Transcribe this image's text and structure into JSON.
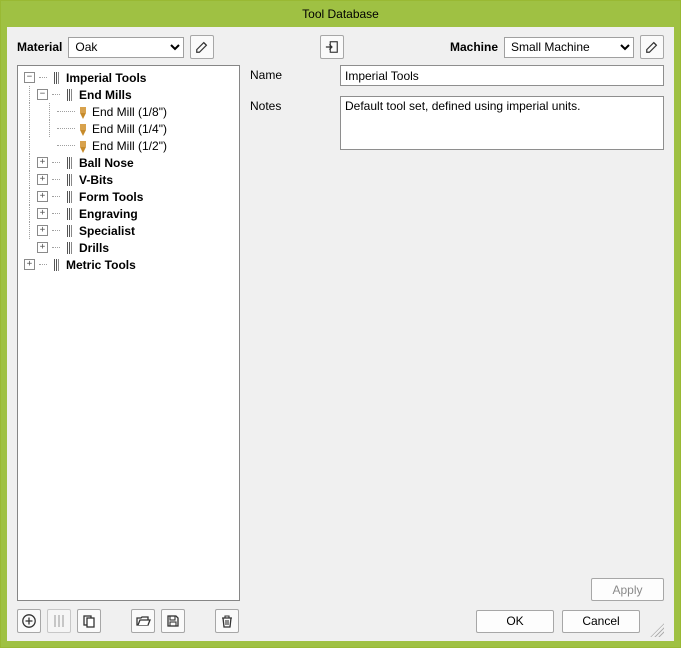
{
  "window": {
    "title": "Tool Database"
  },
  "toolbar": {
    "material_label": "Material",
    "material_value": "Oak",
    "material_options": [
      "Oak"
    ],
    "machine_label": "Machine",
    "machine_value": "Small Machine",
    "machine_options": [
      "Small Machine"
    ]
  },
  "tree": {
    "root": {
      "label": "Imperial Tools",
      "expanded": true,
      "children": [
        {
          "label": "End Mills",
          "expanded": true,
          "children": [
            {
              "label": "End Mill (1/8\")",
              "leaf": true
            },
            {
              "label": "End Mill (1/4\")",
              "leaf": true
            },
            {
              "label": "End Mill (1/2\")",
              "leaf": true
            }
          ]
        },
        {
          "label": "Ball Nose",
          "expanded": false
        },
        {
          "label": "V-Bits",
          "expanded": false
        },
        {
          "label": "Form Tools",
          "expanded": false
        },
        {
          "label": "Engraving",
          "expanded": false
        },
        {
          "label": "Specialist",
          "expanded": false
        },
        {
          "label": "Drills",
          "expanded": false
        }
      ]
    },
    "root2": {
      "label": "Metric Tools",
      "expanded": false
    }
  },
  "detail": {
    "name_label": "Name",
    "name_value": "Imperial Tools",
    "notes_label": "Notes",
    "notes_value": "Default tool set, defined using imperial units.",
    "apply_label": "Apply"
  },
  "buttons": {
    "ok": "OK",
    "cancel": "Cancel"
  }
}
